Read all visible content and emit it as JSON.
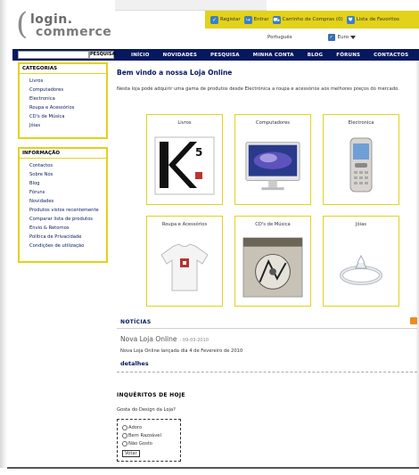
{
  "header": {
    "logo_line1": "login.",
    "logo_line2": "commerce",
    "links": [
      "Registar",
      "Entrar",
      "Carrinho de Compras (0)",
      "Lista de Favoritos"
    ],
    "language": "Português",
    "currency": "Euro"
  },
  "nav": {
    "search_button": "PESQUISA",
    "items": [
      "INÍCIO",
      "NOVIDADES",
      "PESQUISA",
      "MINHA CONTA",
      "BLOG",
      "FÓRUNS",
      "CONTACTOS"
    ]
  },
  "sidebar": {
    "categories_title": "CATEGORIAS",
    "categories": [
      "Livros",
      "Computadores",
      "Electronica",
      "Roupa e Acessórios",
      "CD's de Música",
      "Jóias"
    ],
    "info_title": "INFORMAÇÃO",
    "info": [
      "Contactos",
      "Sobre Nós",
      "Blog",
      "Fóruns",
      "Novidades",
      "Produtos vistos recentemente",
      "Comparar lista de produtos",
      "Envio & Retornos",
      "Política de Privacidade",
      "Condições de utilização"
    ]
  },
  "main": {
    "welcome_title": "Bem vindo a nossa Loja Online",
    "welcome_text": "Nesta loja pode adquirir uma gama de produtos desde Electrónica a roupa e acessórios aos melhores preços do mercado.",
    "categories": [
      {
        "name": "Livros",
        "icon": "book-icon"
      },
      {
        "name": "Computadores",
        "icon": "computer-icon"
      },
      {
        "name": "Electronica",
        "icon": "phone-icon"
      },
      {
        "name": "Roupa e Acessórios",
        "icon": "tshirt-icon"
      },
      {
        "name": "CD's de Música",
        "icon": "cd-icon"
      },
      {
        "name": "Jóias",
        "icon": "ring-icon"
      }
    ],
    "book_cover_text": "K",
    "book_cover_sup": "5"
  },
  "news": {
    "title": "NOTÍCIAS",
    "headline": "Nova Loja Online",
    "date": "- 09-03-2010",
    "body": "Nova Loja Online lançada dia 4 de Fevereiro de 2010",
    "more": "detalhes"
  },
  "poll": {
    "title": "INQUÉRITOS DE HOJE",
    "question": "Gosta do Design da Loja?",
    "options": [
      "Adoro",
      "Bem Razoável",
      "Não Gosto"
    ],
    "vote": "Votar"
  },
  "colors": {
    "accent_yellow": "#e3d21a",
    "nav_blue": "#06185e",
    "link_blue": "#3b7fc4"
  }
}
